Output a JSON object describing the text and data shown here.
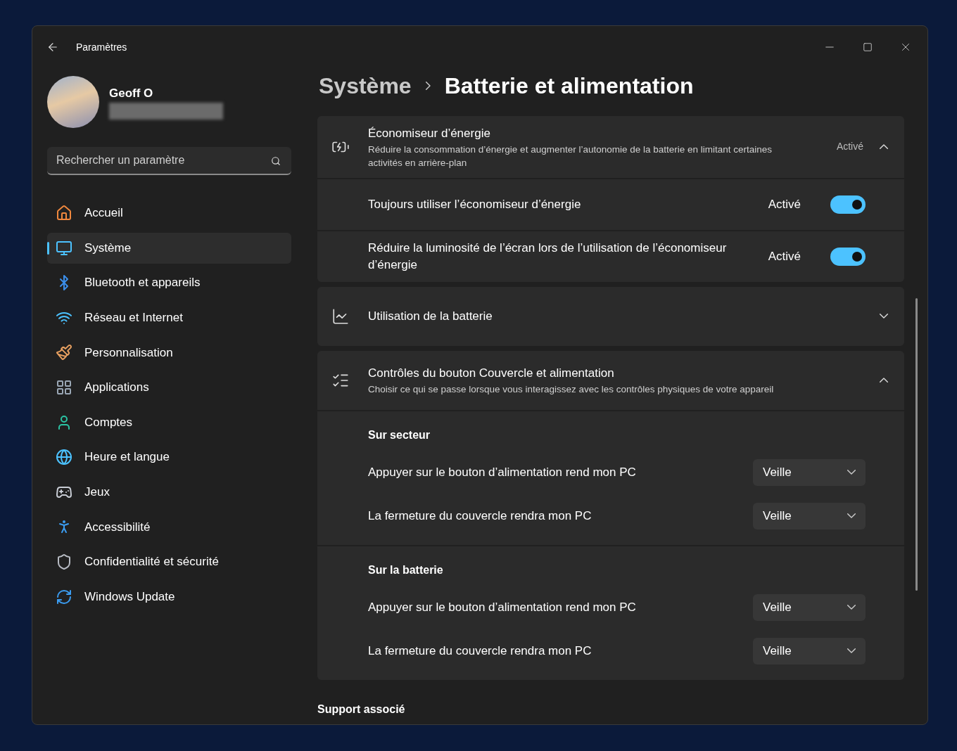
{
  "window": {
    "title": "Paramètres"
  },
  "user": {
    "name": "Geoff O"
  },
  "search": {
    "placeholder": "Rechercher un paramètre"
  },
  "nav": [
    {
      "label": "Accueil",
      "selected": false
    },
    {
      "label": "Système",
      "selected": true
    },
    {
      "label": "Bluetooth et appareils",
      "selected": false
    },
    {
      "label": "Réseau et Internet",
      "selected": false
    },
    {
      "label": "Personnalisation",
      "selected": false
    },
    {
      "label": "Applications",
      "selected": false
    },
    {
      "label": "Comptes",
      "selected": false
    },
    {
      "label": "Heure et langue",
      "selected": false
    },
    {
      "label": "Jeux",
      "selected": false
    },
    {
      "label": "Accessibilité",
      "selected": false
    },
    {
      "label": "Confidentialité et sécurité",
      "selected": false
    },
    {
      "label": "Windows Update",
      "selected": false
    }
  ],
  "breadcrumb": {
    "parent": "Système",
    "current": "Batterie et alimentation"
  },
  "sections": [
    {
      "title": "Économiseur d’énergie",
      "description": "Réduire la consommation d’énergie et augmenter l’autonomie de la batterie en limitant certaines activités en arrière-plan",
      "status": "Activé",
      "expanded": true,
      "rows": [
        {
          "label": "Toujours utiliser l’économiseur d’énergie",
          "status": "Activé",
          "on": true
        },
        {
          "label": "Réduire la luminosité de l’écran lors de l’utilisation de l’économiseur d’énergie",
          "status": "Activé",
          "on": true
        }
      ]
    },
    {
      "title": "Utilisation de la batterie",
      "expanded": false
    },
    {
      "title": "Contrôles du bouton Couvercle et alimentation",
      "description": "Choisir ce qui se passe lorsque vous interagissez avec les contrôles physiques de votre appareil",
      "expanded": true,
      "groups": [
        {
          "heading": "Sur secteur",
          "rows": [
            {
              "label": "Appuyer sur le bouton d’alimentation rend mon PC",
              "value": "Veille"
            },
            {
              "label": "La fermeture du couvercle rendra mon PC",
              "value": "Veille"
            }
          ]
        },
        {
          "heading": "Sur la batterie",
          "rows": [
            {
              "label": "Appuyer sur le bouton d’alimentation rend mon PC",
              "value": "Veille"
            },
            {
              "label": "La fermeture du couvercle rendra mon PC",
              "value": "Veille"
            }
          ]
        }
      ]
    }
  ],
  "footer_heading": "Support associé"
}
